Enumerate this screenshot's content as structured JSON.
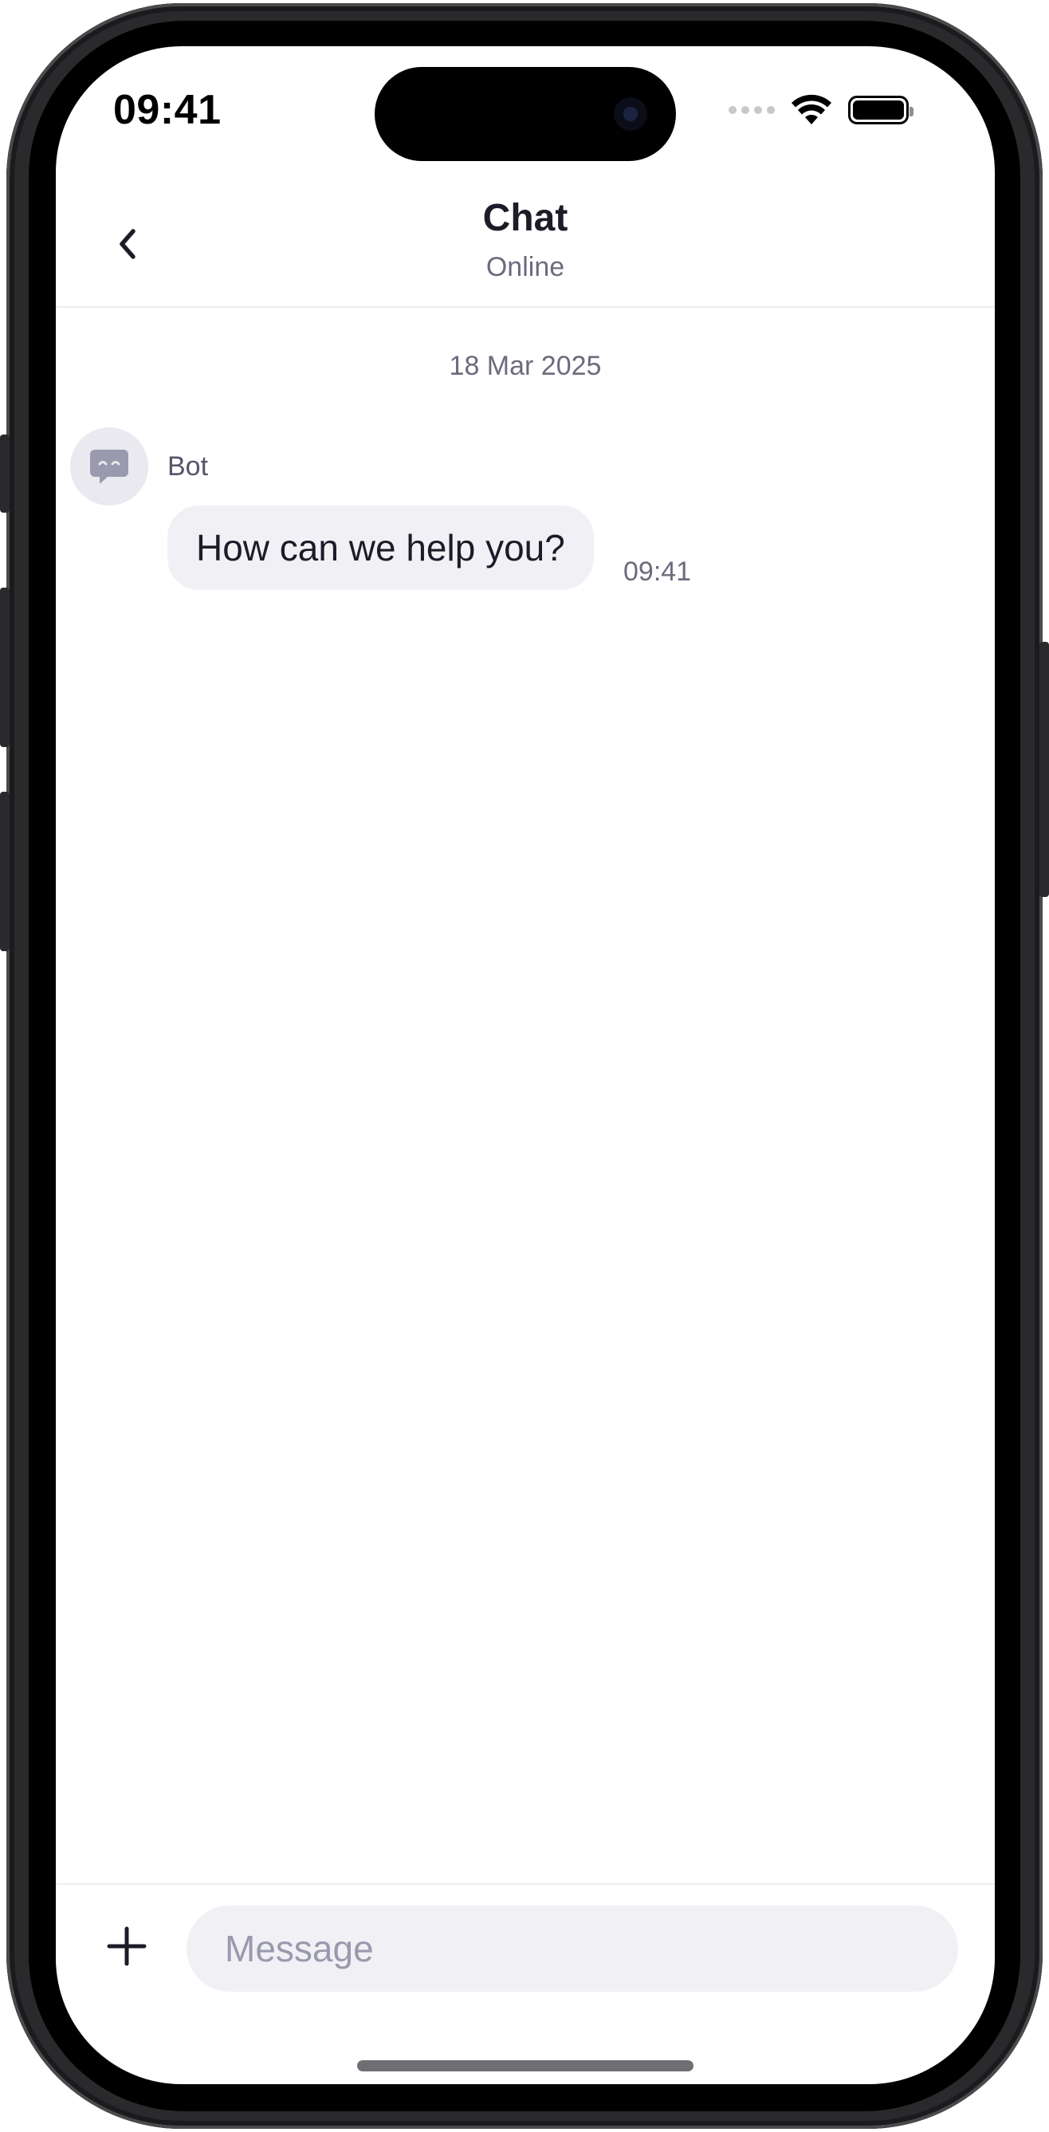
{
  "status_bar": {
    "time": "09:41",
    "icons": [
      "cellular-signal-icon",
      "wifi-icon",
      "battery-icon"
    ]
  },
  "header": {
    "back_icon": "chevron-left-icon",
    "title": "Chat",
    "subtitle": "Online"
  },
  "conversation": {
    "date": "18 Mar 2025",
    "messages": [
      {
        "sender": "Bot",
        "avatar_icon": "chat-bot-icon",
        "text": "How can we help you?",
        "time": "09:41"
      }
    ]
  },
  "composer": {
    "add_icon": "plus-icon",
    "placeholder": "Message",
    "value": ""
  },
  "colors": {
    "primary_text": "#1c1c28",
    "secondary_text": "#6b6b7d",
    "bubble_bg": "#f1f1f5",
    "avatar_bg": "#e9e9ef",
    "avatar_icon": "#9a9aae",
    "divider": "#ececf1"
  }
}
